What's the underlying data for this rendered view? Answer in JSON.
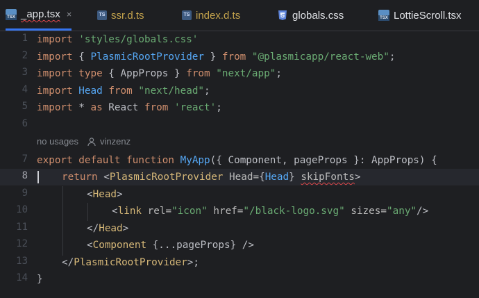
{
  "tabs": [
    {
      "label": "_app.tsx",
      "icon": "tsx-file-icon",
      "active": true,
      "close": "×"
    },
    {
      "label": "ssr.d.ts",
      "icon": "ts-file-icon"
    },
    {
      "label": "index.d.ts",
      "icon": "ts-file-icon"
    },
    {
      "label": "globals.css",
      "icon": "css-file-icon"
    },
    {
      "label": "LottieScroll.tsx",
      "icon": "tsx-file-icon"
    }
  ],
  "icon_text": {
    "ts": "TS",
    "tsx": "TSX"
  },
  "line_numbers": [
    "1",
    "2",
    "3",
    "4",
    "5",
    "6",
    "7",
    "8",
    "9",
    "10",
    "11",
    "12",
    "13",
    "14"
  ],
  "inlay": {
    "usages": "no usages",
    "author": "vinzenz"
  },
  "code": {
    "l1": {
      "kw": "import",
      "str": "'styles/globals.css'"
    },
    "l2": {
      "kw1": "import",
      "p1": " { ",
      "comp": "PlasmicRootProvider",
      "p2": " } ",
      "kw2": "from",
      "p3": " ",
      "str": "\"@plasmicapp/react-web\"",
      "p4": ";"
    },
    "l3": {
      "kw1": "import",
      "kw2": " type",
      "p1": " { AppProps } ",
      "kw3": "from",
      "p2": " ",
      "str": "\"next/app\"",
      "p3": ";"
    },
    "l4": {
      "kw1": "import",
      "p1": " ",
      "comp": "Head",
      "p2": " ",
      "kw2": "from",
      "p3": " ",
      "str": "\"next/head\"",
      "p4": ";"
    },
    "l5": {
      "kw1": "import",
      "p1": " * ",
      "kw2": "as",
      "p2": " React ",
      "kw3": "from",
      "p3": " ",
      "str": "'react'",
      "p4": ";"
    },
    "l7": {
      "kw1": "export",
      "kw2": " default",
      "kw3": " function",
      "p1": " ",
      "fn": "MyApp",
      "p2": "({ Component, pageProps }: AppProps) {"
    },
    "l8": {
      "kw": "return",
      "p1": " <",
      "tag": "PlasmicRootProvider",
      "attr1": " Head=",
      "p2": "{",
      "comp": "Head",
      "p3": "} ",
      "attr2": "skipFonts",
      "p4": ">"
    },
    "l9": {
      "p1": "<",
      "tag": "Head",
      "p2": ">"
    },
    "l10": {
      "p1": "<",
      "tag": "link",
      "attr1": " rel=",
      "s1": "\"icon\"",
      "attr2": " href=",
      "s2": "\"/black-logo.svg\"",
      "attr3": " sizes=",
      "s3": "\"any\"",
      "p2": "/>"
    },
    "l11": {
      "p1": "</",
      "tag": "Head",
      "p2": ">"
    },
    "l12": {
      "p1": "<",
      "tag": "Component",
      "p2": " {...pageProps} />"
    },
    "l13": {
      "p1": "</",
      "tag": "PlasmicRootProvider",
      "p2": ">;"
    },
    "l14": {
      "p1": "}"
    }
  },
  "colors": {
    "background": "#1e1f22",
    "keyword": "#cf8e6d",
    "string": "#6aab73",
    "tag": "#d5b778",
    "identifier": "#56a8f5",
    "accent": "#3574f0",
    "error": "#e0484b"
  }
}
